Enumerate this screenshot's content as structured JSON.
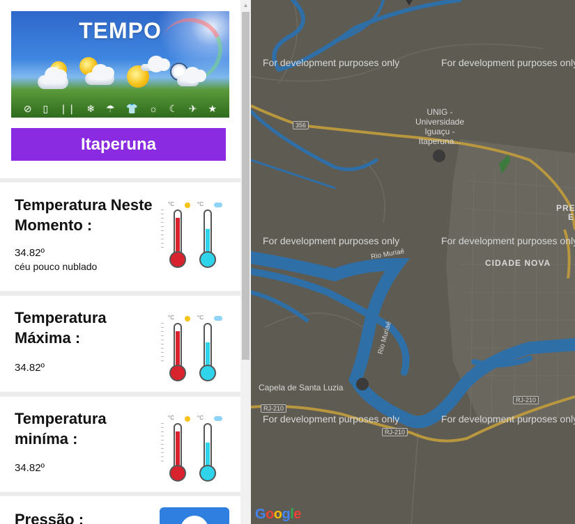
{
  "banner": {
    "title": "TEMPO",
    "icons": [
      "no-location-icon",
      "battery-icon",
      "raindrops-icon",
      "snowflake-icon",
      "umbrella-icon",
      "shirt-icon",
      "sun-icon",
      "moon-icon",
      "satellite-icon",
      "star-icon"
    ]
  },
  "city_button": "Itaperuna",
  "cards": {
    "current": {
      "title": "Temperatura Neste Momento :",
      "value": "34.82º",
      "description": "céu pouco nublado"
    },
    "max": {
      "title": "Temperatura Máxima :",
      "value": "34.82º"
    },
    "min": {
      "title": "Temperatura miníma :",
      "value": "34.82º"
    },
    "pressure": {
      "title": "Pressão :"
    }
  },
  "map": {
    "watermark": "For development purposes only",
    "labels": {
      "unig": "UNIG - Universidade Iguaçu - Itaperuna...",
      "cidade_nova": "CIDADE NOVA",
      "capela": "Capela de Santa Luzia",
      "rio_muriae_1": "Rio Muriaé",
      "rio_muriae_2": "Rio Muriaé",
      "pre": "PRE",
      "e": "E"
    },
    "road_shields": {
      "r356": "356",
      "rj210a": "RJ-210",
      "rj210b": "RJ-210",
      "rj210c": "RJ-210"
    },
    "logo": "Google"
  },
  "colors": {
    "accent": "#8a2be2",
    "map_bg": "#5e5b52",
    "river": "#2f6fa8",
    "road": "#c7a446"
  }
}
